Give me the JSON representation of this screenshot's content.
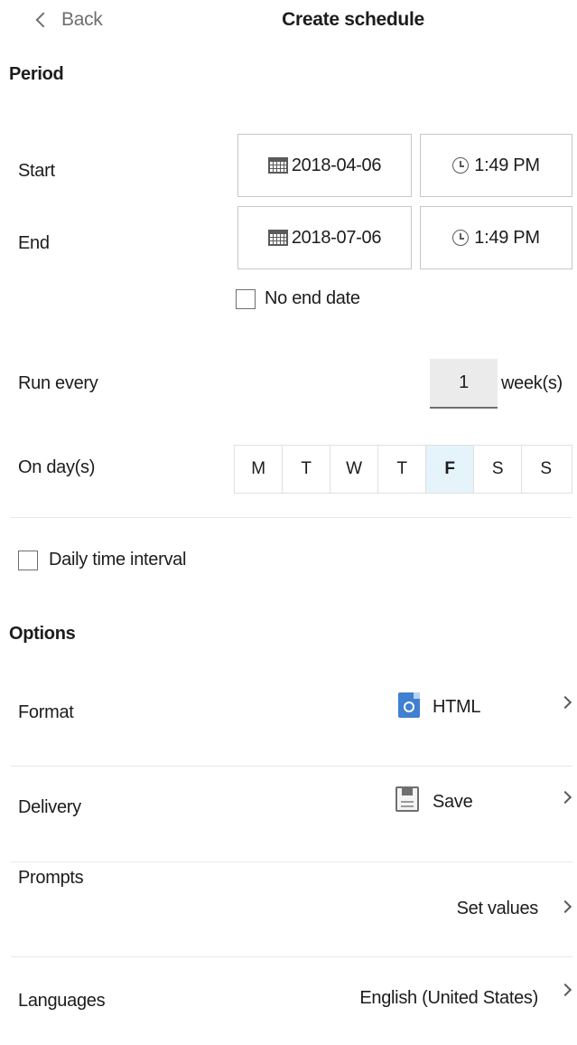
{
  "header": {
    "back_label": "Back",
    "title": "Create schedule"
  },
  "period": {
    "heading": "Period",
    "start": {
      "label": "Start",
      "date": "2018-04-06",
      "time": "1:49 PM"
    },
    "end": {
      "label": "End",
      "date": "2018-07-06",
      "time": "1:49 PM"
    },
    "no_end_date": {
      "label": "No end date",
      "checked": false
    },
    "run_every": {
      "label": "Run every",
      "value": "1",
      "unit": "week(s)"
    },
    "on_days": {
      "label": "On day(s)",
      "days": [
        {
          "letter": "M",
          "selected": false
        },
        {
          "letter": "T",
          "selected": false
        },
        {
          "letter": "W",
          "selected": false
        },
        {
          "letter": "T",
          "selected": false
        },
        {
          "letter": "F",
          "selected": true
        },
        {
          "letter": "S",
          "selected": false
        },
        {
          "letter": "S",
          "selected": false
        }
      ],
      "selected_color": "#e5f3fb"
    },
    "daily_interval": {
      "label": "Daily time interval",
      "checked": false
    }
  },
  "options": {
    "heading": "Options",
    "format": {
      "label": "Format",
      "value": "HTML",
      "icon": "html-file-icon"
    },
    "delivery": {
      "label": "Delivery",
      "value": "Save",
      "icon": "save-icon"
    },
    "prompts": {
      "label": "Prompts",
      "value": "Set values"
    },
    "languages": {
      "label": "Languages",
      "value": "English (United States)"
    }
  }
}
